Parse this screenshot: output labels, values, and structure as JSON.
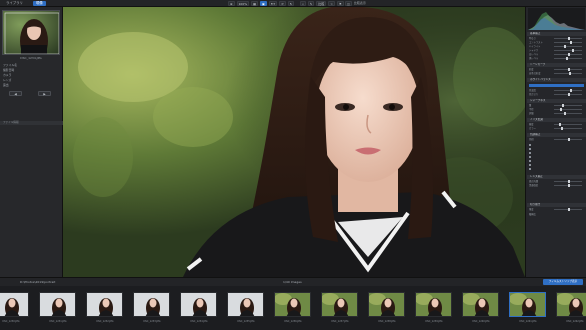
{
  "tabs": {
    "library": "ライブラリ",
    "develop": "現像"
  },
  "toolbar": {
    "zoom": "100%",
    "fit": "FIT",
    "view_mode": "比較",
    "compare": "比較表示"
  },
  "left_panel": {
    "preview_filename": "DSC_1234.JPG",
    "rows": [
      {
        "label": "ファイル名",
        "value": ""
      },
      {
        "label": "撮影日時",
        "value": ""
      },
      {
        "label": "カメラ",
        "value": ""
      },
      {
        "label": "レンズ",
        "value": ""
      },
      {
        "label": "露出",
        "value": ""
      }
    ],
    "buttons": [
      "◀",
      "▶"
    ],
    "footer": "ファイル情報"
  },
  "right_panel": {
    "sections": [
      "基本補正",
      "トーンカーブ",
      "ホワイトバランス",
      "シャープネス",
      "ノイズ低減",
      "色調補正",
      "レンズ補正",
      "切り抜き"
    ],
    "rows": [
      "明るさ",
      "コントラスト",
      "ハイライト",
      "シャドウ",
      "白レベル",
      "黒レベル",
      "彩度",
      "自然な彩度",
      "色温度",
      "色かぶり",
      "量",
      "半径",
      "詳細",
      "輝度",
      "カラー",
      "色相",
      "周辺光量",
      "歪曲収差",
      "角度",
      "縦横比"
    ]
  },
  "filmstrip": {
    "path": "D:\\Photos\\2019\\portrait",
    "count": "1/40 Images",
    "mode_button": "フィルムストリップ表示",
    "labels": [
      "DSC_1230.JPG",
      "DSC_1231.JPG",
      "DSC_1232.JPG",
      "DSC_1233.JPG",
      "DSC_1234.JPG",
      "DSC_1235.JPG",
      "DSC_1236.JPG",
      "DSC_1237.JPG",
      "DSC_1238.JPG",
      "DSC_1239.JPG",
      "DSC_1240.JPG",
      "DSC_1241.JPG",
      "DSC_1242.JPG"
    ]
  },
  "colors": {
    "accent": "#2f6fc4",
    "panel": "#27282b",
    "background": "#1b1c1e"
  }
}
